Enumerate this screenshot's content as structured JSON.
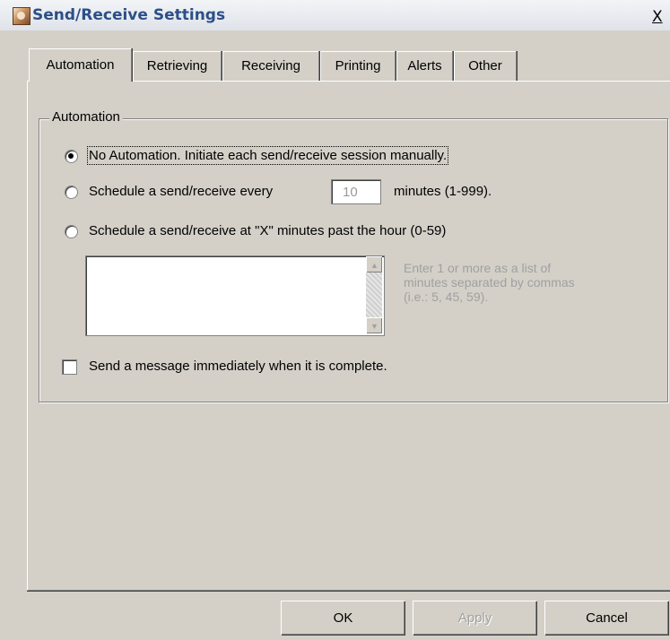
{
  "window": {
    "title": "Send/Receive Settings",
    "close_label": "X"
  },
  "tabs": [
    {
      "label": "Automation",
      "active": true
    },
    {
      "label": "Retrieving",
      "active": false
    },
    {
      "label": "Receiving",
      "active": false
    },
    {
      "label": "Printing",
      "active": false
    },
    {
      "label": "Alerts",
      "active": false
    },
    {
      "label": "Other",
      "active": false
    }
  ],
  "automation": {
    "group_title": "Automation",
    "options": [
      {
        "label": "No Automation.  Initiate each send/receive session manually.",
        "selected": true
      },
      {
        "label": "Schedule a send/receive every",
        "selected": false,
        "suffix": "minutes (1-999)."
      },
      {
        "label": "Schedule a send/receive at \"X\" minutes past the hour (0-59)",
        "selected": false
      }
    ],
    "minutes_value": "10",
    "minutes_list_value": "",
    "hint": "Enter 1 or more as a list of\nminutes separated by commas\n(i.e.: 5, 45, 59).",
    "send_immediately": {
      "label": "Send a message immediately when it is complete.",
      "checked": false
    }
  },
  "buttons": {
    "ok": "OK",
    "apply": "Apply",
    "cancel": "Cancel"
  }
}
